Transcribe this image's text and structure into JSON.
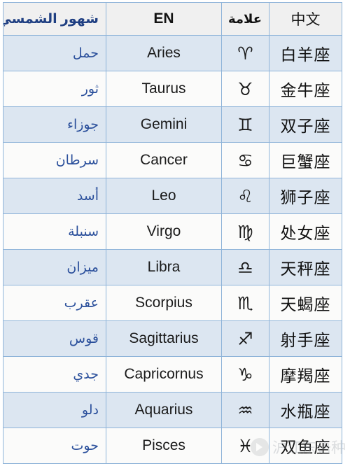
{
  "table": {
    "columns": [
      {
        "key": "arabic",
        "label": "شهور الشمسي"
      },
      {
        "key": "english",
        "label": "EN"
      },
      {
        "key": "symbol",
        "label": "علامة"
      },
      {
        "key": "chinese",
        "label": "中文"
      }
    ],
    "rows": [
      {
        "arabic": "حمل",
        "english": "Aries",
        "symbol": "♈",
        "symbol_name": "aries-glyph",
        "chinese": "白羊座"
      },
      {
        "arabic": "ثور",
        "english": "Taurus",
        "symbol": "♉",
        "symbol_name": "taurus-glyph",
        "chinese": "金牛座"
      },
      {
        "arabic": "جوزاء",
        "english": "Gemini",
        "symbol": "♊",
        "symbol_name": "gemini-glyph",
        "chinese": "双子座"
      },
      {
        "arabic": "سرطان",
        "english": "Cancer",
        "symbol": "♋",
        "symbol_name": "cancer-glyph",
        "chinese": "巨蟹座"
      },
      {
        "arabic": "أسد",
        "english": "Leo",
        "symbol": "♌",
        "symbol_name": "leo-glyph",
        "chinese": "狮子座"
      },
      {
        "arabic": "سنبلة",
        "english": "Virgo",
        "symbol": "♍",
        "symbol_name": "virgo-glyph",
        "chinese": "处女座"
      },
      {
        "arabic": "ميزان",
        "english": "Libra",
        "symbol": "♎",
        "symbol_name": "libra-glyph",
        "chinese": "天秤座"
      },
      {
        "arabic": "عقرب",
        "english": "Scorpius",
        "symbol": "♏",
        "symbol_name": "scorpius-glyph",
        "chinese": "天蝎座"
      },
      {
        "arabic": "قوس",
        "english": "Sagittarius",
        "symbol": "♐",
        "symbol_name": "sagittarius-glyph",
        "chinese": "射手座"
      },
      {
        "arabic": "جدي",
        "english": "Capricornus",
        "symbol": "♑",
        "symbol_name": "capricornus-glyph",
        "chinese": "摩羯座"
      },
      {
        "arabic": "دلو",
        "english": "Aquarius",
        "symbol": "♒",
        "symbol_name": "aquarius-glyph",
        "chinese": "水瓶座"
      },
      {
        "arabic": "حوت",
        "english": "Pisces",
        "symbol": "♓",
        "symbol_name": "pisces-glyph",
        "chinese": "双鱼座"
      }
    ]
  },
  "watermark": {
    "text": "沪江东语种",
    "logo_icon": "play-circle-icon"
  },
  "colors": {
    "header_background": "#f0f0f0",
    "header_arabic_text": "#1f3f82",
    "row_odd_background": "#dce6f1",
    "row_even_background": "#fbfbfa",
    "border": "#8fb4d9",
    "arabic_text": "#2a4f9b",
    "watermark_text": "#9aa0a6"
  }
}
